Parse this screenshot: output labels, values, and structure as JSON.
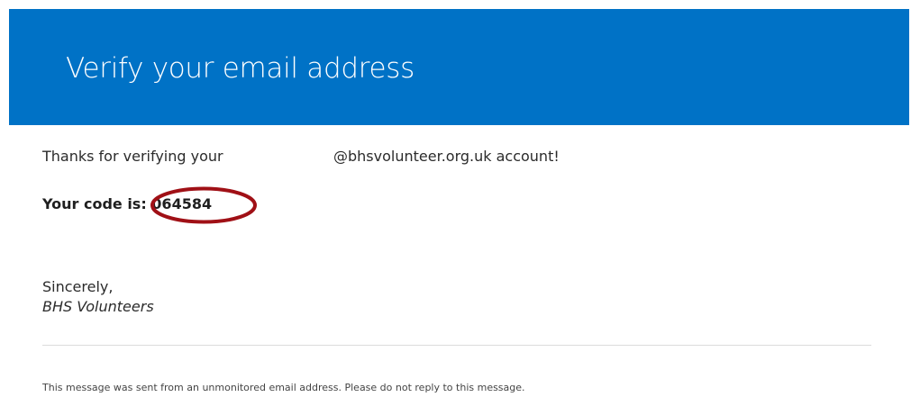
{
  "header": {
    "title": "Verify your email address",
    "background_color": "#0072c6"
  },
  "message": {
    "thanks_prefix": "Thanks for verifying your",
    "thanks_suffix": "@bhsvolunteer.org.uk account!",
    "code_label": "Your code is: ",
    "code_value": "064584",
    "highlight_color": "#a01016",
    "sign_off": "Sincerely,",
    "signature": "BHS Volunteers"
  },
  "footer": {
    "note": "This message was sent from an unmonitored email address. Please do not reply to this message."
  }
}
